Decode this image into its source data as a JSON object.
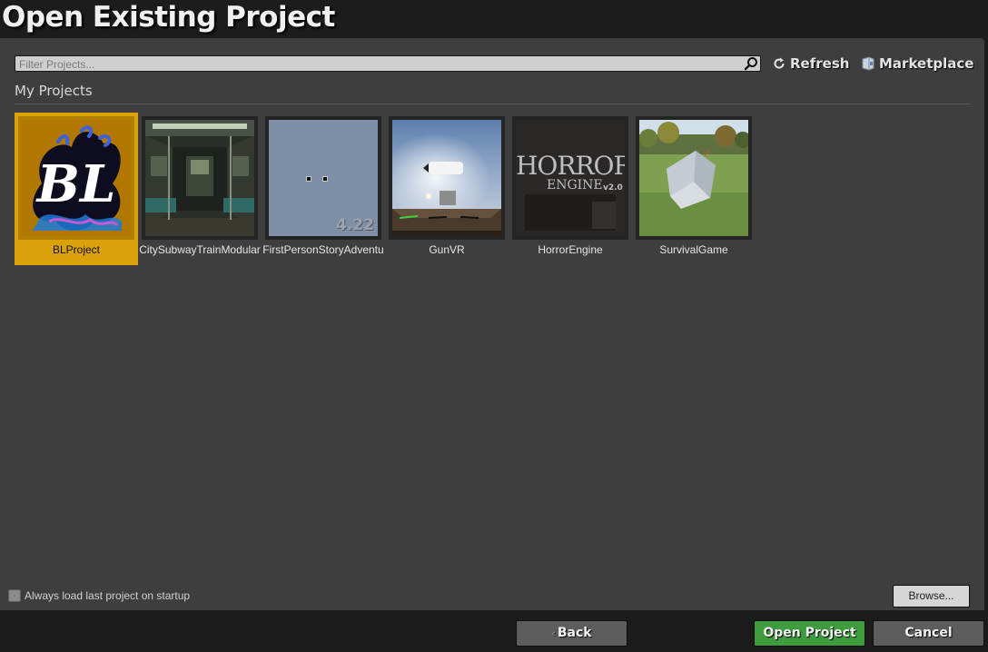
{
  "window": {
    "title": "Open Existing Project"
  },
  "search": {
    "placeholder": "Filter Projects..."
  },
  "toolbar": {
    "refresh_label": "Refresh",
    "marketplace_label": "Marketplace"
  },
  "section": {
    "label": "My Projects"
  },
  "projects": [
    {
      "name": "BLProject",
      "selected": true,
      "logo_text": "BL"
    },
    {
      "name": "CitySubwayTrainModular",
      "selected": false
    },
    {
      "name": "FirstPersonStoryAdventu",
      "selected": false,
      "version": "4.22"
    },
    {
      "name": "GunVR",
      "selected": false
    },
    {
      "name": "HorrorEngine",
      "selected": false,
      "logo_text": "HORROR",
      "logo_subtext": "ENGINE",
      "logo_version": "v2.0"
    },
    {
      "name": "SurvivalGame",
      "selected": false
    }
  ],
  "options": {
    "always_load_label": "Always load last project on startup",
    "always_load_checked": false
  },
  "buttons": {
    "browse": "Browse...",
    "back": "Back",
    "open": "Open Project",
    "cancel": "Cancel"
  },
  "colors": {
    "selection": "#dba10a",
    "open_button": "#3e9b3e",
    "panel": "#3e3e3e",
    "background": "#1c1c1c"
  }
}
